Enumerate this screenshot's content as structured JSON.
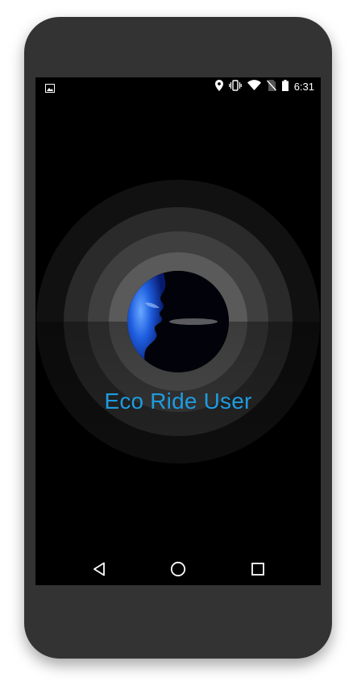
{
  "status_bar": {
    "time": "6:31",
    "icons": [
      "image-notification-icon",
      "location-icon",
      "vibrate-icon",
      "wifi-icon",
      "no-sim-icon",
      "battery-icon"
    ]
  },
  "splash": {
    "app_name": "Eco Ride User",
    "logo": "voice-face-logo"
  },
  "nav_bar": {
    "buttons": [
      "back-icon",
      "home-icon",
      "recents-icon"
    ]
  },
  "colors": {
    "device_frame": "#333333",
    "screen_bg": "#000000",
    "title_color": "#1e9be0",
    "ring_outer": "#111111",
    "ring_2": "#2a2a2a",
    "ring_3": "#3f3f3f",
    "ring_inner": "#5a5a5a"
  }
}
